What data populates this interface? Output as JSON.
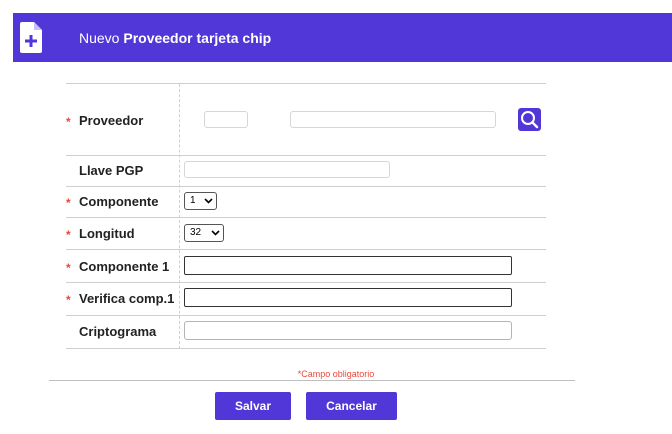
{
  "header": {
    "prefix": "Nuevo",
    "title": "Proveedor tarjeta chip",
    "icon": "add-document-icon"
  },
  "form": {
    "required_mark": "*",
    "fields": [
      {
        "label": "Proveedor",
        "required": true,
        "type": "lookup",
        "code_value": "",
        "name_value": ""
      },
      {
        "label": "Llave PGP",
        "required": false,
        "type": "text",
        "value": ""
      },
      {
        "label": "Componente",
        "required": true,
        "type": "select",
        "value": "1"
      },
      {
        "label": "Longitud",
        "required": true,
        "type": "select",
        "value": "32"
      },
      {
        "label": "Componente 1",
        "required": true,
        "type": "text",
        "value": ""
      },
      {
        "label": "Verifica comp.1",
        "required": true,
        "type": "text",
        "value": ""
      },
      {
        "label": "Criptograma",
        "required": false,
        "type": "text",
        "value": ""
      }
    ]
  },
  "required_note": "*Campo obligatorio",
  "buttons": {
    "save": "Salvar",
    "cancel": "Cancelar"
  },
  "colors": {
    "accent": "#5237d8",
    "required": "#e8493a",
    "border": "#cfcfcf"
  }
}
